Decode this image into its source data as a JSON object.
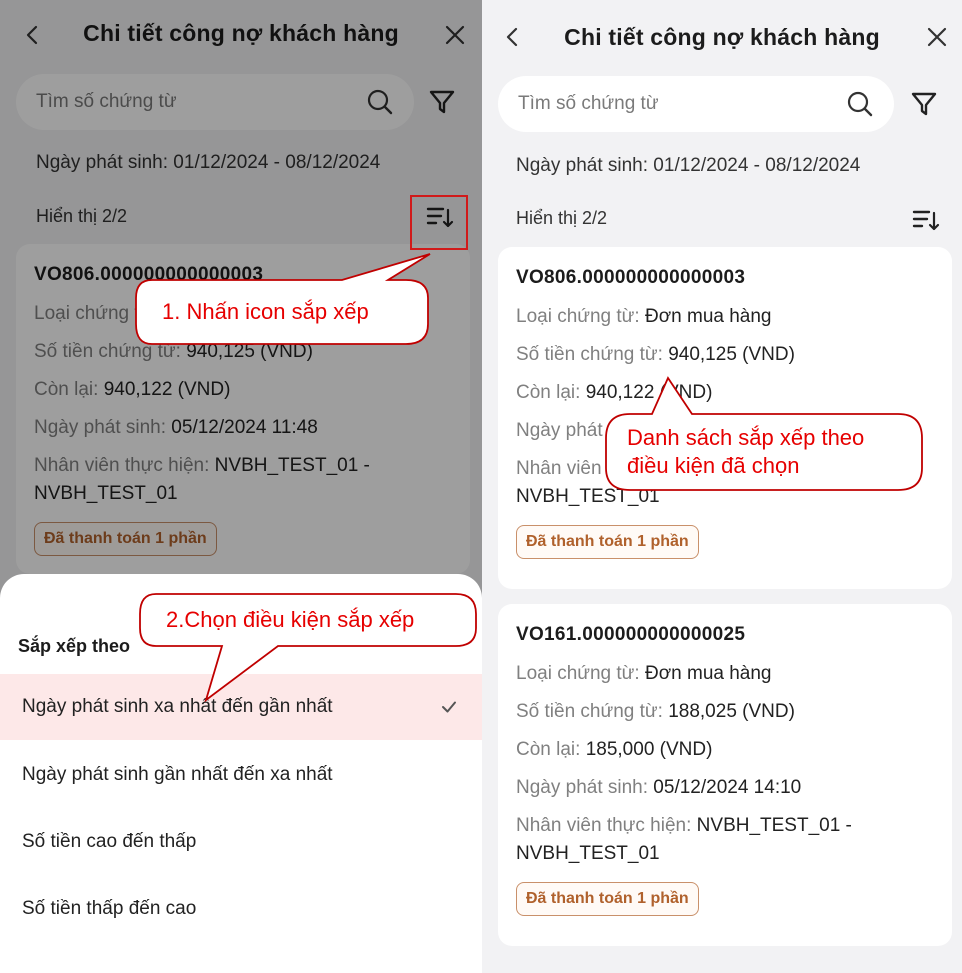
{
  "left": {
    "header": {
      "back_icon": "chevron-left-icon",
      "title": "Chi tiết công nợ khách hàng",
      "close_icon": "close-icon"
    },
    "search": {
      "placeholder": "Tìm số chứng từ",
      "icon": "search-icon"
    },
    "filter_icon": "filter-icon",
    "date_range": "Ngày phát sinh: 01/12/2024 - 08/12/2024",
    "showing": "Hiển thị 2/2",
    "sort_icon": "sort-icon",
    "card": {
      "code": "VO806.000000000000003",
      "doc_type_label": "Loại chứng từ:",
      "amount_label": "Số tiền chứng từ:",
      "amount_value": " 940,125 (VND)",
      "remaining_label": "Còn lại:",
      "remaining_value": " 940,122 (VND)",
      "date_label": "Ngày phát sinh:",
      "date_value": " 05/12/2024 11:48",
      "staff_label": "Nhân viên thực hiện:",
      "staff_value": " NVBH_TEST_01 -",
      "staff_value2": "NVBH_TEST_01",
      "status": "Đã thanh toán 1 phần"
    },
    "sort_sheet": {
      "title": "Sắp xếp theo",
      "options": [
        "Ngày phát sinh xa nhất đến gần nhất",
        "Ngày phát sinh gần nhất đến xa nhất",
        "Số tiền cao đến thấp",
        "Số tiền thấp đến cao"
      ],
      "selected_index": 0,
      "check_icon": "check-icon"
    },
    "callouts": {
      "step1": "1. Nhấn icon sắp xếp",
      "step2": "2.Chọn điều kiện sắp xếp"
    }
  },
  "right": {
    "header": {
      "back_icon": "chevron-left-icon",
      "title": "Chi tiết công nợ khách hàng",
      "close_icon": "close-icon"
    },
    "search": {
      "placeholder": "Tìm số chứng từ",
      "icon": "search-icon"
    },
    "filter_icon": "filter-icon",
    "date_range": "Ngày phát sinh: 01/12/2024 - 08/12/2024",
    "showing": "Hiển thị 2/2",
    "sort_icon": "sort-icon",
    "cards": [
      {
        "code": "VO806.000000000000003",
        "doc_type_label": "Loại chứng từ:",
        "doc_type_value": " Đơn mua hàng",
        "amount_label": "Số tiền chứng từ:",
        "amount_value": " 940,125 (VND)",
        "remaining_label": "Còn lại:",
        "remaining_value": " 940,122 (VND)",
        "date_label": "Ngày phát",
        "staff_label": "Nhân viên",
        "staff_value2": "NVBH_TEST_01",
        "status": "Đã thanh toán 1 phần"
      },
      {
        "code": "VO161.000000000000025",
        "doc_type_label": "Loại chứng từ:",
        "doc_type_value": " Đơn mua hàng",
        "amount_label": "Số tiền chứng từ:",
        "amount_value": " 188,025 (VND)",
        "remaining_label": "Còn lại:",
        "remaining_value": " 185,000 (VND)",
        "date_label": "Ngày phát sinh:",
        "date_value": " 05/12/2024 14:10",
        "staff_label": "Nhân viên thực hiện:",
        "staff_value": " NVBH_TEST_01 -",
        "staff_value2": "NVBH_TEST_01",
        "status": "Đã thanh toán 1 phần"
      }
    ],
    "callouts": {
      "result_line1": "Danh sách sắp xếp theo",
      "result_line2": "điều kiện đã chọn"
    }
  },
  "colors": {
    "annotation_red": "#e60000",
    "badge_border": "#c9906a",
    "badge_text": "#b0612c",
    "selected_option_bg": "#fde8e8",
    "highlight_box": "#d11a1a"
  }
}
